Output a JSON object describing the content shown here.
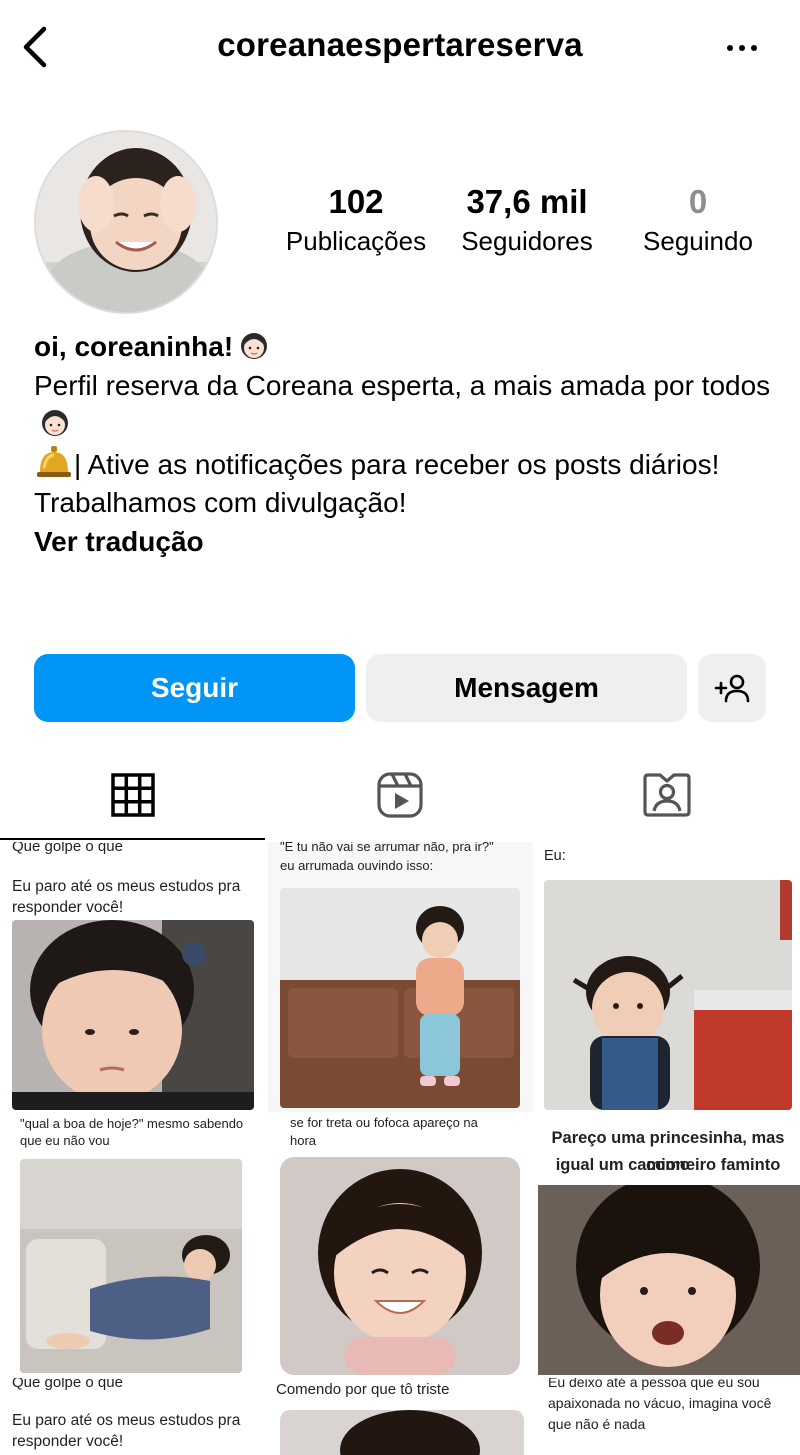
{
  "header": {
    "username": "coreanaespertareserva"
  },
  "stats": {
    "posts": {
      "value": "102",
      "label": "Publicações"
    },
    "followers": {
      "value": "37,6 mil",
      "label": "Seguidores"
    },
    "following": {
      "value": "0",
      "label": "Seguindo"
    }
  },
  "bio": {
    "name": "oi, coreaninha!",
    "line1": "Perfil reserva da Coreana esperta, a mais amada por todos",
    "line2": "| Ative as notificações para receber os posts diários!",
    "line3": "Trabalhamos com divulgação!",
    "translate": "Ver tradução"
  },
  "actions": {
    "follow": "Seguir",
    "message": "Mensagem"
  },
  "colors": {
    "accent": "#0095f6",
    "secondary_button": "#efefef"
  },
  "posts": [
    {
      "caption_top": "Que golpe o que",
      "caption": "Eu paro até os meus estudos pra responder você!",
      "caption_bottom": ""
    },
    {
      "caption_top": "\"E tu não vai se arrumar não, pra ir?\"",
      "caption": "eu arrumada ouvindo isso:",
      "caption_bottom": ""
    },
    {
      "caption_top": "",
      "caption": "Eu:",
      "caption_bottom": ""
    },
    {
      "caption_top": "\"qual a boa de hoje?\" mesmo sabendo",
      "caption": "que eu não vou",
      "caption_bottom": ""
    },
    {
      "caption_top": "se for treta ou fofoca apareço na",
      "caption": "hora",
      "caption_bottom": ""
    },
    {
      "caption_top": "Pareço uma princesinha, mas como",
      "caption": "igual um camioneiro faminto",
      "caption_bottom": ""
    },
    {
      "caption_top": "Que golpe o que",
      "caption": "Eu paro até os meus estudos pra responder você!",
      "caption_bottom": ""
    },
    {
      "caption_top": "",
      "caption": "Comendo por que tô triste",
      "caption_bottom": ""
    },
    {
      "caption_top": "Eu deixo até a pessoa que eu sou",
      "caption": "apaixonada no vácuo, imagina você que não é nada",
      "caption_bottom": ""
    }
  ],
  "icons": {
    "back": "chevron-left-icon",
    "more": "more-horizontal-icon",
    "add_user": "add-user-icon",
    "grid": "grid-icon",
    "reels": "reels-icon",
    "tagged": "tagged-icon"
  }
}
